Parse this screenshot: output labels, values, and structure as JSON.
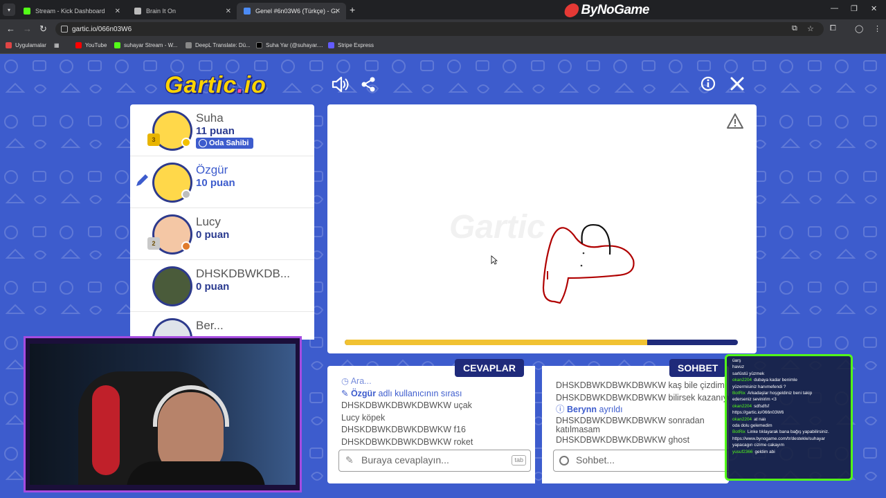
{
  "browser": {
    "tabs": [
      {
        "title": "Stream - Kick Dashboard",
        "color": "#53fc18"
      },
      {
        "title": "Brain It On",
        "color": "#ffffff"
      },
      {
        "title": "Genel #6n03W6 (Türkçe) - Garti",
        "color": "#4c8bf5"
      }
    ],
    "brand": "ByNoGame",
    "url": "gartic.io/066n03W6",
    "bookmarks": [
      {
        "label": "Uygulamalar",
        "color": "#e04545"
      },
      {
        "label": "YouTube",
        "color": "#ff0000"
      },
      {
        "label": "suhayar Stream - W...",
        "color": "#53fc18"
      },
      {
        "label": "DeepL Translate: Dü...",
        "color": "#888888"
      },
      {
        "label": "Suha Yar (@suhayar....",
        "color": "#000000"
      },
      {
        "label": "Stripe Express",
        "color": "#635bff"
      }
    ]
  },
  "game": {
    "logo": "Gartic.io",
    "players": [
      {
        "name": "Suha",
        "score": "11 puan",
        "badge": "Oda Sahibi",
        "trophy": "3",
        "status_color": "#f2c100"
      },
      {
        "name": "Özgür",
        "score": "10 puan",
        "drawing": true,
        "status_color": "#bdbdbd"
      },
      {
        "name": "Lucy",
        "score": "0 puan",
        "trophy": "2",
        "status_color": "#e07b2c"
      },
      {
        "name": "DHSKDBWKDB...",
        "score": "0 puan"
      },
      {
        "name": "Ber...",
        "score": ""
      }
    ],
    "timer_fraction": 0.77
  },
  "answers": {
    "label": "CEVAPLAR",
    "messages": [
      {
        "type": "sys",
        "text": "Ara..."
      },
      {
        "type": "sys",
        "who": "Özgür",
        "text": "adlı kullanıcının sırası"
      },
      {
        "who": "DHSKDBWKDBWKDBWKW",
        "text": "uçak"
      },
      {
        "who": "Lucy",
        "text": "köpek"
      },
      {
        "who": "DHSKDBWKDBWKDBWKW",
        "text": "f16"
      },
      {
        "who": "DHSKDBWKDBWKDBWKW",
        "text": "roket"
      }
    ],
    "placeholder": "Buraya cevaplayın...",
    "tab_hint": "tab"
  },
  "chat": {
    "label": "SOHBET",
    "messages": [
      {
        "who": "DHSKDBWKDBWKDBWKW",
        "text": "kaş bile çizdim"
      },
      {
        "who": "DHSKDBWKDBWKDBWKW",
        "text": "bilirsek kazanıyor"
      },
      {
        "type": "sys",
        "who": "Berynn",
        "text": "ayrıldı"
      },
      {
        "who": "DHSKDBWKDBWKDBWKW",
        "text": "sonradan katılmasam"
      },
      {
        "who": "DHSKDBWKDBWKDBWKW",
        "text": "ghost"
      }
    ],
    "placeholder": "Sohbet..."
  },
  "kick_chat": [
    {
      "u": "",
      "t": "üarş"
    },
    {
      "u": "",
      "t": "havuz"
    },
    {
      "u": "",
      "t": "sarlüstü yüzmek"
    },
    {
      "u": "okan2204",
      "t": "dubaya kadar benimle"
    },
    {
      "u": "",
      "t": "yüzermisiniz hanımefendi ?"
    },
    {
      "u": "BotRix",
      "t": "Arkadaşlar hoşgeldiniz beni takip"
    },
    {
      "u": "",
      "t": "ederseniz sevinirim <3"
    },
    {
      "u": "okan2204",
      "t": "sdfsdfsf"
    },
    {
      "u": "",
      "t": "https://gartic.io/066n03W6"
    },
    {
      "u": "okan2204",
      "t": "at naiı"
    },
    {
      "u": "",
      "t": "oda dolu gelemedim"
    },
    {
      "u": "",
      "t": ""
    },
    {
      "u": "BotRix",
      "t": "Linke tıklayarak bana bağış yapabilirsiniz."
    },
    {
      "u": "",
      "t": "https://www.bynogame.com/tr/destekle/suhayar"
    },
    {
      "u": "",
      "t": "yapacagın cizime cakayım"
    },
    {
      "u": "yusuf2366",
      "t": "geldim abi"
    }
  ]
}
